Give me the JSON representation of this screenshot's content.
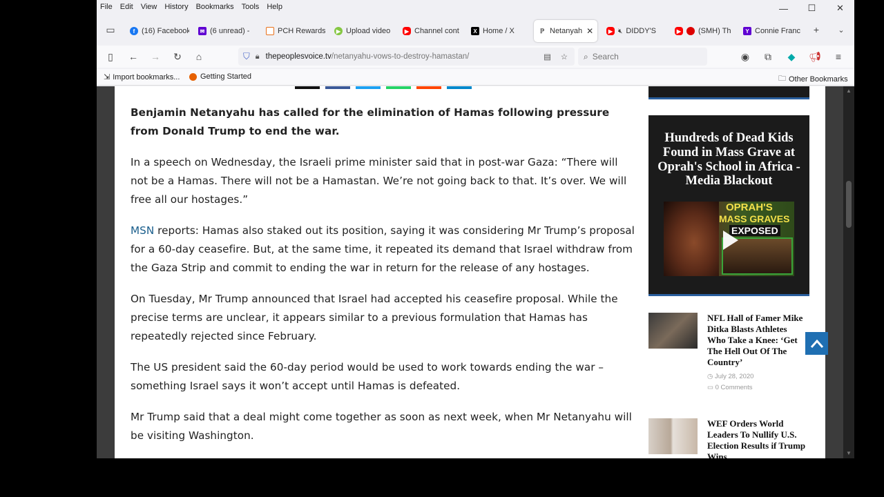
{
  "menu": [
    "File",
    "Edit",
    "View",
    "History",
    "Bookmarks",
    "Tools",
    "Help"
  ],
  "tabs": [
    {
      "label": "(16) Facebook",
      "icon": "facebook-icon",
      "color": "#1877f2"
    },
    {
      "label": "(6 unread) - ",
      "icon": "yahoo-mail-icon",
      "color": "#6001d2"
    },
    {
      "label": "PCH Rewards",
      "icon": "pch-icon",
      "color": "#e8701a"
    },
    {
      "label": "Upload video",
      "icon": "rumble-icon",
      "color": "#85c742"
    },
    {
      "label": "Channel cont",
      "icon": "youtube-icon",
      "color": "#ff0000"
    },
    {
      "label": "Home / X",
      "icon": "x-icon",
      "color": "#000000"
    },
    {
      "label": "Netanyah",
      "icon": "site-icon",
      "color": "#555555"
    },
    {
      "label": "DIDDY'S",
      "icon": "youtube-icon",
      "color": "#ff0000"
    },
    {
      "label": "(SMH) Th",
      "icon": "youtube-icon",
      "color": "#ff0000"
    },
    {
      "label": "Connie Franc",
      "icon": "yahoo-icon",
      "color": "#6001d2"
    }
  ],
  "url": {
    "domain": "thepeoplesvoice.tv",
    "path": "/netanyahu-vows-to-destroy-hamastan/"
  },
  "search": {
    "placeholder": "Search"
  },
  "bookmarks": {
    "import": "Import bookmarks...",
    "started": "Getting Started",
    "other": "Other Bookmarks"
  },
  "article": {
    "lead": "Benjamin Netanyahu has called for the elimination of Hamas following pressure from Donald Trump to end the war.",
    "p1": "In a speech on Wednesday, the Israeli prime minister said that in post-war Gaza: “There will not be a Hamas. There will not be a Hamastan. We’re not going back to that. It’s over. We will free all our hostages.”",
    "p2_link": "MSN",
    "p2": " reports: Hamas also staked out its position, saying it was considering Mr Trump’s proposal for a 60-day ceasefire. But, at the same time, it repeated its demand that Israel withdraw from the Gaza Strip and commit to ending the war in return for the release of any hostages.",
    "p3": "On Tuesday, Mr Trump announced that Israel had accepted his ceasefire proposal. While the precise terms are unclear, it appears similar to a previous formulation that Hamas has repeatedly rejected since February.",
    "p4": "The US president said the 60-day period would be used to work towards ending the war – something Israel says it won’t accept until Hamas is defeated.",
    "p5": "Mr Trump said that a deal might come together as soon as next week, when Mr Netanyahu will be visiting Washington."
  },
  "ad": {
    "title": "Hundreds of Dead Kids Found in Mass Grave at Oprah's School in Africa - Media Blackout",
    "img_line1": "OPRAH'S",
    "img_line2": "MASS GRAVES",
    "img_line3": "EXPOSED"
  },
  "news": [
    {
      "title": "NFL Hall of Famer Mike Ditka Blasts Athletes Who Take a Knee: ‘Get The Hell Out Of The Country’",
      "date": "July 28, 2020",
      "comments": "0 Comments"
    },
    {
      "title": "WEF Orders World Leaders To Nullify U.S. Election Results if Trump Wins",
      "date": "",
      "comments": ""
    }
  ],
  "colors": {
    "link": "#1a5e8c",
    "accent": "#1f6fb2"
  }
}
